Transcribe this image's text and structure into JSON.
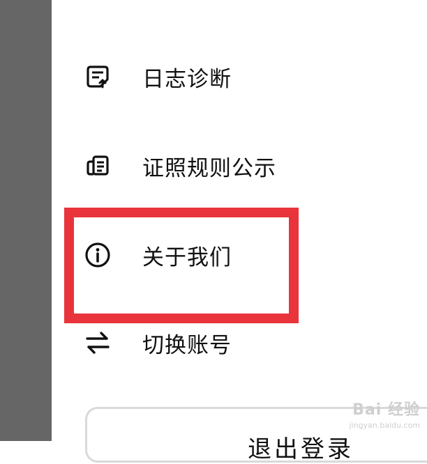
{
  "menu": {
    "items": [
      {
        "label": "日志诊断",
        "icon": "log-upload-icon"
      },
      {
        "label": "证照规则公示",
        "icon": "license-doc-icon"
      },
      {
        "label": "关于我们",
        "icon": "info-icon"
      },
      {
        "label": "切换账号",
        "icon": "swap-arrows-icon"
      }
    ]
  },
  "logout": {
    "label": "退出登录"
  },
  "highlight": {
    "color": "#e8343a"
  },
  "watermark": {
    "main": "Bai 经验",
    "sub": "jingyan.baidu.com"
  },
  "colors": {
    "side_strip": "#666666",
    "text": "#111111"
  }
}
